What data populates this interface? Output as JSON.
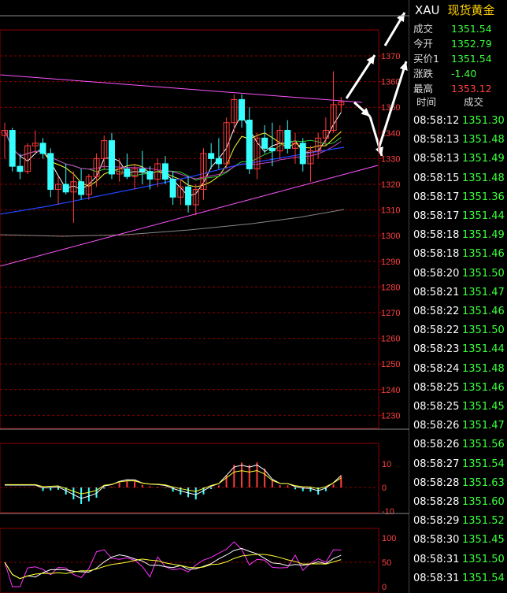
{
  "quote": {
    "symbol": "XAU",
    "name": "现货黄金",
    "rows": [
      {
        "label": "成交",
        "value": "1351.54",
        "color": "#3bff3b"
      },
      {
        "label": "今开",
        "value": "1352.79",
        "color": "#3bff3b"
      },
      {
        "label": "买价1",
        "value": "1351.54",
        "color": "#3bff3b"
      },
      {
        "label": "涨跌",
        "value": "-1.40",
        "color": "#3bff3b"
      },
      {
        "label": "最高",
        "value": "1353.12",
        "color": "#ff4040"
      }
    ]
  },
  "ticks_header": {
    "time": "时间",
    "price": "成交"
  },
  "ticks": [
    {
      "time": "08:58:12",
      "price": "1351.30"
    },
    {
      "time": "08:58:13",
      "price": "1351.48"
    },
    {
      "time": "08:58:13",
      "price": "1351.49"
    },
    {
      "time": "08:58:15",
      "price": "1351.48"
    },
    {
      "time": "08:58:17",
      "price": "1351.36"
    },
    {
      "time": "08:58:17",
      "price": "1351.44"
    },
    {
      "time": "08:58:18",
      "price": "1351.49"
    },
    {
      "time": "08:58:18",
      "price": "1351.46"
    },
    {
      "time": "08:58:20",
      "price": "1351.50"
    },
    {
      "time": "08:58:21",
      "price": "1351.47"
    },
    {
      "time": "08:58:22",
      "price": "1351.46"
    },
    {
      "time": "08:58:22",
      "price": "1351.50"
    },
    {
      "time": "08:58:23",
      "price": "1351.44"
    },
    {
      "time": "08:58:24",
      "price": "1351.48"
    },
    {
      "time": "08:58:25",
      "price": "1351.46"
    },
    {
      "time": "08:58:25",
      "price": "1351.45"
    },
    {
      "time": "08:58:26",
      "price": "1351.47"
    },
    {
      "time": "08:58:26",
      "price": "1351.56"
    },
    {
      "time": "08:58:27",
      "price": "1351.54"
    },
    {
      "time": "08:58:28",
      "price": "1351.63"
    },
    {
      "time": "08:58:28",
      "price": "1351.60"
    },
    {
      "time": "08:58:29",
      "price": "1351.52"
    },
    {
      "time": "08:58:30",
      "price": "1351.45"
    },
    {
      "time": "08:58:31",
      "price": "1351.50"
    },
    {
      "time": "08:58:31",
      "price": "1351.54"
    }
  ],
  "chart_data": {
    "type": "candlestick",
    "price_axis": {
      "ticks": [
        1370,
        1360,
        1350,
        1340,
        1330,
        1320,
        1310,
        1300,
        1290,
        1280,
        1270,
        1260,
        1250,
        1240,
        1230
      ],
      "range": [
        1226,
        1372
      ]
    },
    "candles": [
      [
        1339,
        1344,
        1330,
        1341
      ],
      [
        1341,
        1342,
        1325,
        1327
      ],
      [
        1327,
        1332,
        1322,
        1325
      ],
      [
        1325,
        1336,
        1324,
        1335
      ],
      [
        1335,
        1341,
        1332,
        1336
      ],
      [
        1336,
        1338,
        1330,
        1332
      ],
      [
        1332,
        1334,
        1315,
        1318
      ],
      [
        1318,
        1323,
        1312,
        1320
      ],
      [
        1320,
        1328,
        1316,
        1317
      ],
      [
        1317,
        1325,
        1305,
        1321
      ],
      [
        1321,
        1326,
        1314,
        1316
      ],
      [
        1316,
        1324,
        1314,
        1323
      ],
      [
        1323,
        1332,
        1319,
        1330
      ],
      [
        1330,
        1339,
        1326,
        1337
      ],
      [
        1337,
        1340,
        1322,
        1324
      ],
      [
        1324,
        1330,
        1321,
        1326
      ],
      [
        1326,
        1332,
        1322,
        1323
      ],
      [
        1323,
        1328,
        1318,
        1326
      ],
      [
        1326,
        1333,
        1320,
        1325
      ],
      [
        1325,
        1327,
        1318,
        1322
      ],
      [
        1322,
        1330,
        1319,
        1328
      ],
      [
        1328,
        1331,
        1320,
        1322
      ],
      [
        1322,
        1325,
        1312,
        1315
      ],
      [
        1315,
        1322,
        1312,
        1319
      ],
      [
        1319,
        1323,
        1309,
        1312
      ],
      [
        1312,
        1320,
        1308,
        1318
      ],
      [
        1318,
        1334,
        1314,
        1332
      ],
      [
        1332,
        1336,
        1326,
        1330
      ],
      [
        1330,
        1338,
        1326,
        1328
      ],
      [
        1328,
        1346,
        1326,
        1344
      ],
      [
        1344,
        1355,
        1340,
        1353
      ],
      [
        1353,
        1355,
        1342,
        1345
      ],
      [
        1345,
        1350,
        1324,
        1326
      ],
      [
        1326,
        1340,
        1322,
        1338
      ],
      [
        1338,
        1343,
        1332,
        1334
      ],
      [
        1334,
        1344,
        1327,
        1333
      ],
      [
        1333,
        1343,
        1330,
        1341
      ],
      [
        1341,
        1345,
        1332,
        1334
      ],
      [
        1334,
        1340,
        1328,
        1336
      ],
      [
        1336,
        1338,
        1325,
        1328
      ],
      [
        1328,
        1335,
        1321,
        1333
      ],
      [
        1333,
        1340,
        1330,
        1338
      ],
      [
        1338,
        1346,
        1335,
        1341
      ],
      [
        1341,
        1364,
        1340,
        1351
      ],
      [
        1351,
        1354,
        1348,
        1352
      ]
    ],
    "macd_axis": {
      "ticks": [
        10,
        0,
        -10
      ]
    },
    "rsi_axis": {
      "ticks": [
        100,
        50,
        0
      ]
    }
  },
  "colors": {
    "up": "#ff3b3b",
    "down": "#37ffff",
    "grid": "#8b0000",
    "trend": "#ff55ff",
    "axis_text": "#ff4040"
  }
}
